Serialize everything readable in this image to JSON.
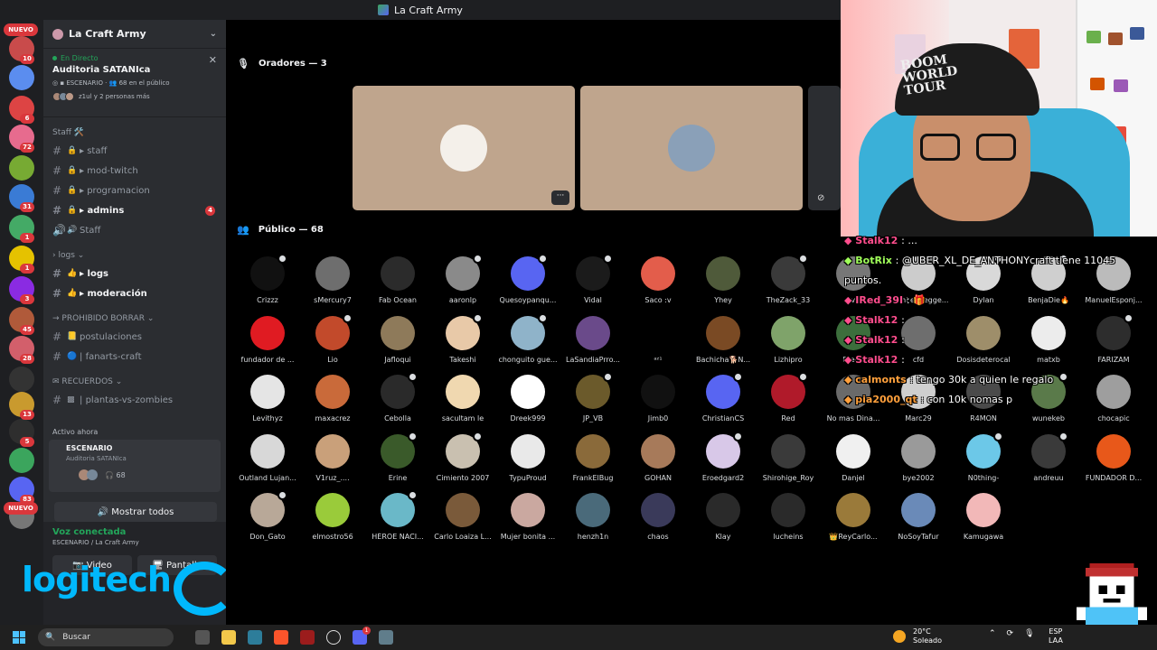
{
  "window": {
    "title": "La Craft Army"
  },
  "rail": {
    "new_label": "NUEVO",
    "badges": [
      "10",
      "6",
      "72",
      "31",
      "1",
      "1",
      "3",
      "45",
      "28",
      "13",
      "5",
      "83"
    ]
  },
  "sidebar": {
    "server_name": "La Craft Army",
    "live": {
      "status": "En Directo",
      "title": "Auditoria SATANIca",
      "kind": "ESCENARIO",
      "audience": "68 en el público",
      "others": "z1ul y 2 personas más"
    },
    "categories": {
      "staff": "Staff 🛠️",
      "logs": "logs",
      "prohibido": "PROHIBIDO BORRAR",
      "recuerdos": "RECUERDOS"
    },
    "channels": [
      {
        "name": "staff"
      },
      {
        "name": "mod-twitch"
      },
      {
        "name": "programacion"
      },
      {
        "name": "admins",
        "badge": "4"
      },
      {
        "name": "Staff"
      },
      {
        "name": "logs"
      },
      {
        "name": "moderación"
      },
      {
        "name": "postulaciones"
      },
      {
        "name": "fanarts-craft"
      },
      {
        "name": "plantas-vs-zombies"
      }
    ],
    "active_now": "Activo ahora",
    "stage_card": {
      "kind": "ESCENARIO",
      "title": "Auditoria SATANIca",
      "count": "68"
    },
    "show_all": "Mostrar todos",
    "voice": {
      "status": "Voz conectada",
      "location": "ESCENARIO / La Craft Army",
      "video_label": "Video",
      "screen_label": "Pantalla"
    },
    "overlay_logo": "logitech"
  },
  "main": {
    "speakers_title": "Oradores — 3",
    "audience_title": "Público — 68",
    "audience": [
      "Crizzz",
      "sMercury7",
      "Fab Ocean",
      "aaronlp",
      "Quesoypanqu...",
      "Vidal",
      "Saco :v",
      "Yhey",
      "TheZack_33",
      "live",
      "Mami el negge...",
      "Dylan",
      "BenjaDie🔥",
      "ManuelEsponj...",
      "fundador de ...",
      "Lio",
      "Jafloqui",
      "Takeshi",
      "chonguito gue...",
      "LaSandiaPrro...",
      "ᵃᶻ¹",
      "Bachicha🐕N...",
      "Lizhipro",
      "Diego",
      "cfd",
      "Dosisdeterocal",
      "matxb",
      "FARIZAM",
      "Levithyz",
      "maxacrez",
      "Cebolla",
      "sacultam le",
      "Dreek999",
      "JP_VB",
      "Jimb0",
      "ChristianCS",
      "Red",
      "No mas Dina...",
      "Marc29",
      "R4MON",
      "wunekeb",
      "chocapic",
      "Outland Lujan...",
      "V1ruz_....",
      "Erine",
      "Cimiento 2007",
      "TypuProud",
      "FrankElBug",
      "GOHAN",
      "Eroedgard2",
      "Shirohige_Roy",
      "Danjel",
      "bye2002",
      "N0thing-",
      "andreuu",
      "FUNDADOR D...",
      "Don_Gato",
      "elmostro56",
      "HÉROE NACI...",
      "Carlo Loaiza L...",
      "Mujer bonita ...",
      "henzh1n",
      "chaos",
      "Klay",
      "lucheins",
      "👑ReyCarlo...",
      "NoSoyTafur",
      "Kamugawa"
    ],
    "audience_colors": [
      "#111111",
      "#6e6e6e",
      "#2b2b2b",
      "#8a8a8a",
      "#5865f2",
      "#1b1b1b",
      "#e35d4b",
      "#4f5a3a",
      "#3a3a3a",
      "#777777",
      "#cccccc",
      "#d9d9d9",
      "#cfcfcf",
      "#bbbbbb",
      "#e01b22",
      "#c24a2b",
      "#8e7a5a",
      "#e8c9a8",
      "#8fb3c9",
      "#6a4a8a",
      "#000000",
      "#7a4a24",
      "#7fa36a",
      "#3c6e3c",
      "#6e6e6e",
      "#9e8e6a",
      "#ececec",
      "#2d2d2d",
      "#e5e5e5",
      "#c96a3a",
      "#2a2a2a",
      "#f0d8b0",
      "#ffffff",
      "#6b5a2b",
      "#111111",
      "#5865f2",
      "#b01a2a",
      "#6a6a6a",
      "#cfcfcf",
      "#4a4a4a",
      "#5a7a4a",
      "#9e9e9e",
      "#d8d8d8",
      "#c9a07a",
      "#3a5a2a",
      "#c9c0b0",
      "#e9e9e9",
      "#8a6a3a",
      "#a77a5a",
      "#d8c8e8",
      "#3a3a3a",
      "#f0f0f0",
      "#9a9a9a",
      "#6cc8e8",
      "#3a3a3a",
      "#e8581a",
      "#b8a898",
      "#9acb3a",
      "#6ab8c8",
      "#7a5a3a",
      "#caa8a0",
      "#4a6a7a",
      "#3a3a5a",
      "#2a2a2a",
      "#2a2a2a",
      "#9a7a3a",
      "#6a8ab8",
      "#f2b8b8"
    ],
    "hand_raised": [
      0,
      3,
      4,
      5,
      8,
      10,
      11,
      12,
      15,
      17,
      18,
      27,
      30,
      33,
      35,
      36,
      40,
      44,
      45,
      49,
      53,
      54,
      56,
      58
    ],
    "speaker_colors": [
      "#bfa58d",
      "#bfa58d"
    ]
  },
  "chat": [
    {
      "user": "Stalk12",
      "msg": ": ...",
      "color": "u2"
    },
    {
      "user": "BotRix",
      "msg": ": @UBER_XL_DE_ANTHONYcraft tiene 11045",
      "color": "u"
    },
    {
      "user": "",
      "msg": "puntos.",
      "color": "m"
    },
    {
      "user": "IRed_39I",
      "msg": ": 🎁",
      "color": "u2"
    },
    {
      "user": "Stalk12",
      "msg": ":",
      "color": "u2"
    },
    {
      "user": "Stalk12",
      "msg": ":",
      "color": "u2"
    },
    {
      "user": "Stalk12",
      "msg": ":",
      "color": "u2"
    },
    {
      "user": "calmonts",
      "msg": ": tengo 30k a quien le regalo",
      "color": "u4"
    },
    {
      "user": "pia2000_qt",
      "msg": ": con 10k nomas p",
      "color": "u4"
    }
  ],
  "taskbar": {
    "search_placeholder": "Buscar",
    "weather_temp": "20°C",
    "weather_desc": "Soleado",
    "lang_top": "ESP",
    "lang_bottom": "LAA",
    "discord_badge": "1"
  },
  "colors": {
    "accent": "#5865f2",
    "live_green": "#23a55a",
    "alert_red": "#da373c",
    "logi_blue": "#00b8fc"
  }
}
